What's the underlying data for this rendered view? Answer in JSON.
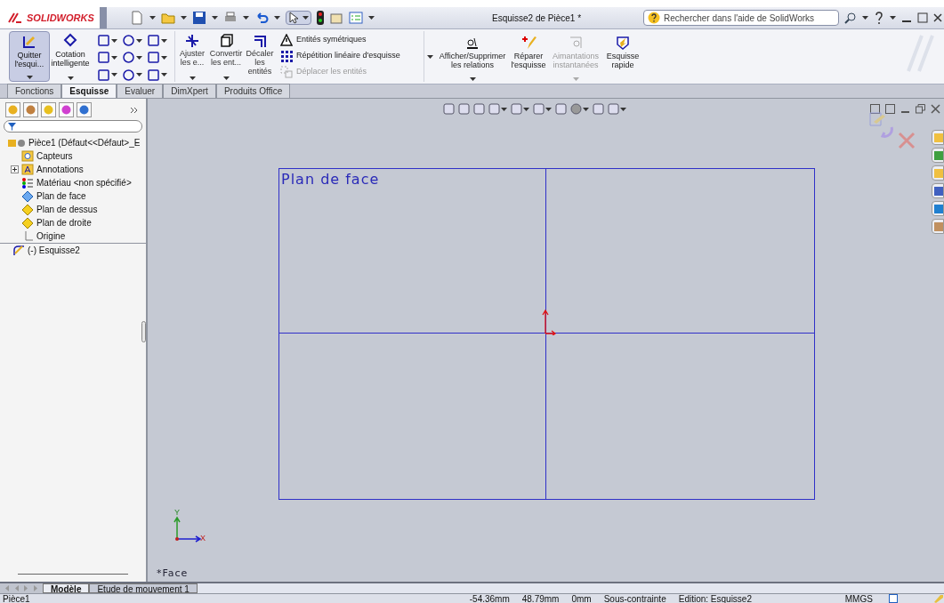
{
  "title_bar": {
    "logo": "SOLIDWORKS",
    "title": "Esquisse2 de Pièce1 *",
    "search_placeholder": "Rechercher dans l'aide de SolidWorks"
  },
  "ribbon": {
    "large_buttons": [
      {
        "label": "Quitter l'esqui...",
        "kind": "exit",
        "selected": true,
        "disabled": false
      },
      {
        "label": "Cotation intelligente",
        "kind": "dimension",
        "selected": false,
        "disabled": false
      }
    ],
    "trim_buttons": [
      {
        "label": "Ajuster les e...",
        "kind": "trim"
      },
      {
        "label": "Convertir les ent...",
        "kind": "convert"
      },
      {
        "label": "Décaler les entités",
        "kind": "offset"
      }
    ],
    "list_items": [
      {
        "label": "Entités symétriques",
        "kind": "mirror",
        "disabled": false
      },
      {
        "label": "Répétition linéaire d'esquisse",
        "kind": "pattern",
        "disabled": false
      },
      {
        "label": "Déplacer les entités",
        "kind": "move",
        "disabled": true
      }
    ],
    "right_buttons": [
      {
        "label": "Afficher/Supprimer les relations",
        "kind": "relations",
        "disabled": false
      },
      {
        "label": "Réparer l'esquisse",
        "kind": "repair",
        "disabled": false
      },
      {
        "label": "Aimantations instantanées",
        "kind": "snap",
        "disabled": true
      },
      {
        "label": "Esquisse rapide",
        "kind": "quick",
        "disabled": false
      }
    ]
  },
  "command_tabs": [
    {
      "label": "Fonctions",
      "selected": false
    },
    {
      "label": "Esquisse",
      "selected": true
    },
    {
      "label": "Evaluer",
      "selected": false
    },
    {
      "label": "DimXpert",
      "selected": false
    },
    {
      "label": "Produits Office",
      "selected": false
    }
  ],
  "tree": {
    "root": "Pièce1  (Défaut<<Défaut>_E",
    "children": [
      {
        "label": "Capteurs",
        "kind": "sensor"
      },
      {
        "label": "Annotations",
        "kind": "annotation",
        "expanded": false
      },
      {
        "label": "Matériau <non spécifié>",
        "kind": "material"
      },
      {
        "label": "Plan de face",
        "kind": "plane_front"
      },
      {
        "label": "Plan de dessus",
        "kind": "plane"
      },
      {
        "label": "Plan de droite",
        "kind": "plane"
      },
      {
        "label": "Origine",
        "kind": "origin"
      }
    ],
    "after": [
      {
        "label": "(-) Esquisse2",
        "kind": "sketch"
      }
    ]
  },
  "viewport": {
    "plane_label": "Plan de face",
    "view_label": "*Face",
    "axis_y": "Y",
    "axis_x": "X"
  },
  "bottom_tabs": [
    {
      "label": "Modèle",
      "selected": true
    },
    {
      "label": "Etude de mouvement 1",
      "selected": false
    }
  ],
  "status_bar": [
    "Pièce1",
    "-54.36mm",
    "48.79mm",
    "0mm",
    "Sous-contrainte",
    "Edition: Esquisse2",
    "MMGS"
  ]
}
